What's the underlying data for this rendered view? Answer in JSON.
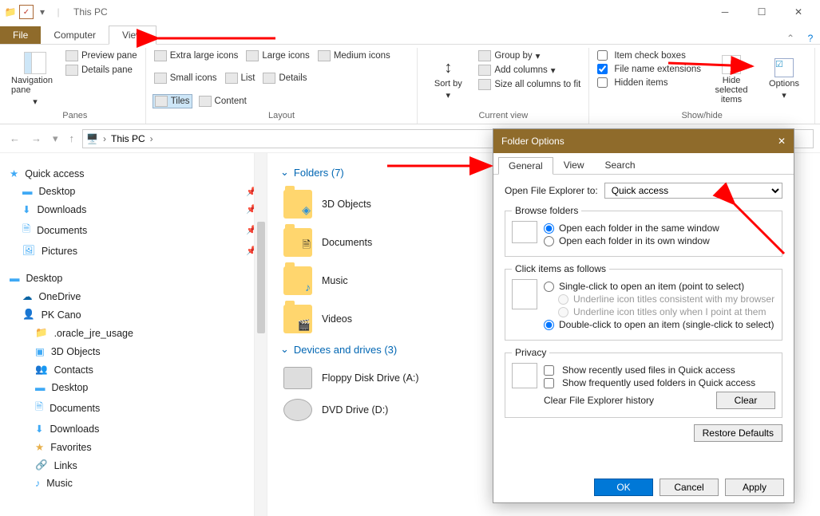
{
  "window": {
    "title": "This PC"
  },
  "tabs": {
    "file": "File",
    "computer": "Computer",
    "view": "View"
  },
  "ribbon": {
    "panes": {
      "label": "Panes",
      "nav": "Navigation pane",
      "preview": "Preview pane",
      "details": "Details pane"
    },
    "layout": {
      "label": "Layout",
      "xlarge": "Extra large icons",
      "large": "Large icons",
      "medium": "Medium icons",
      "small": "Small icons",
      "list": "List",
      "detailsv": "Details",
      "tiles": "Tiles",
      "content": "Content"
    },
    "sort": {
      "label": "Current view",
      "sortby": "Sort by",
      "groupby": "Group by",
      "addcols": "Add columns",
      "sizecols": "Size all columns to fit"
    },
    "showhide": {
      "label": "Show/hide",
      "itemcheck": "Item check boxes",
      "ext": "File name extensions",
      "hidden": "Hidden items",
      "hidesel": "Hide selected items",
      "options": "Options"
    }
  },
  "breadcrumb": {
    "thispc": "This PC"
  },
  "tree": {
    "quick": "Quick access",
    "desktop": "Desktop",
    "downloads": "Downloads",
    "documents": "Documents",
    "pictures": "Pictures",
    "desktop2": "Desktop",
    "onedrive": "OneDrive",
    "user": "PK Cano",
    "items": [
      ".oracle_jre_usage",
      "3D Objects",
      "Contacts",
      "Desktop",
      "Documents",
      "Downloads",
      "Favorites",
      "Links",
      "Music"
    ]
  },
  "folders": {
    "hdr": "Folders (7)",
    "list": [
      "3D Objects",
      "Documents",
      "Music",
      "Videos"
    ],
    "hdr2": "Devices and drives (3)",
    "drives": [
      "Floppy Disk Drive (A:)",
      "DVD Drive (D:)"
    ]
  },
  "dialog": {
    "title": "Folder Options",
    "tabs": {
      "general": "General",
      "view": "View",
      "search": "Search"
    },
    "openlabel": "Open File Explorer to:",
    "openvalue": "Quick access",
    "browse": {
      "legend": "Browse folders",
      "same": "Open each folder in the same window",
      "own": "Open each folder in its own window"
    },
    "click": {
      "legend": "Click items as follows",
      "single": "Single-click to open an item (point to select)",
      "u1": "Underline icon titles consistent with my browser",
      "u2": "Underline icon titles only when I point at them",
      "double": "Double-click to open an item (single-click to select)"
    },
    "privacy": {
      "legend": "Privacy",
      "recent": "Show recently used files in Quick access",
      "freq": "Show frequently used folders in Quick access",
      "clearlbl": "Clear File Explorer history",
      "clear": "Clear"
    },
    "restore": "Restore Defaults",
    "ok": "OK",
    "cancel": "Cancel",
    "apply": "Apply"
  }
}
